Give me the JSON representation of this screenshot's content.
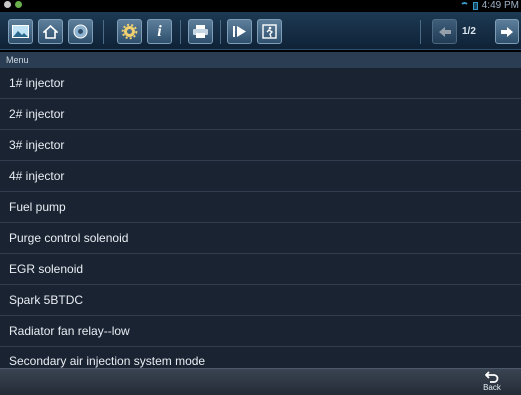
{
  "status": {
    "time": "4:49 PM",
    "colors": {
      "notif1": "#c8c8c8",
      "notif2": "#6ab04c"
    }
  },
  "toolbar": {
    "buttons": [
      {
        "icon": "image-icon"
      },
      {
        "icon": "home-icon"
      },
      {
        "icon": "vehicle-icon"
      },
      {
        "icon": "settings-icon"
      },
      {
        "icon": "info-icon",
        "glyph": "i"
      },
      {
        "icon": "print-icon"
      },
      {
        "icon": "play-record-icon"
      },
      {
        "icon": "exit-icon"
      }
    ],
    "page_indicator": "1/2"
  },
  "menu": {
    "header": "Menu",
    "items": [
      "1# injector",
      "2# injector",
      "3# injector",
      "4# injector",
      "Fuel pump",
      "Purge control solenoid",
      "EGR solenoid",
      "Spark 5BTDC",
      "Radiator fan relay--low",
      "Secondary air injection system mode"
    ]
  },
  "bottom": {
    "back_label": "Back"
  }
}
